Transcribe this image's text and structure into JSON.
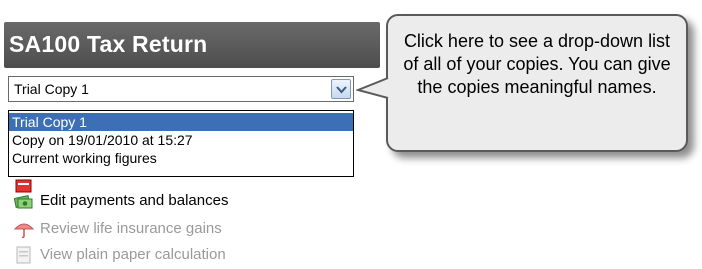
{
  "panel": {
    "title": "SA100 Tax Return"
  },
  "copy_selector": {
    "selected_value": "Trial Copy 1",
    "options": [
      {
        "label": "Trial Copy 1",
        "selected": true
      },
      {
        "label": "Copy on 19/01/2010 at 15:27",
        "selected": false
      },
      {
        "label": "Current working figures",
        "selected": false
      }
    ]
  },
  "tasks": [
    {
      "label": "",
      "icon": "red-document-icon",
      "enabled": true
    },
    {
      "label": "Edit payments and balances",
      "icon": "money-notes-icon",
      "enabled": true
    },
    {
      "label": "Review life insurance gains",
      "icon": "umbrella-icon",
      "enabled": false
    },
    {
      "label": "View plain paper calculation",
      "icon": "document-icon",
      "enabled": false
    }
  ],
  "callout": {
    "text": "Click here to see a drop-down list of all of your copies. You can give the copies meaningful names."
  },
  "colors": {
    "title_bar": "#5a5a5a",
    "selected_option": "#3d6fb5",
    "callout_bg": "#ececec"
  }
}
